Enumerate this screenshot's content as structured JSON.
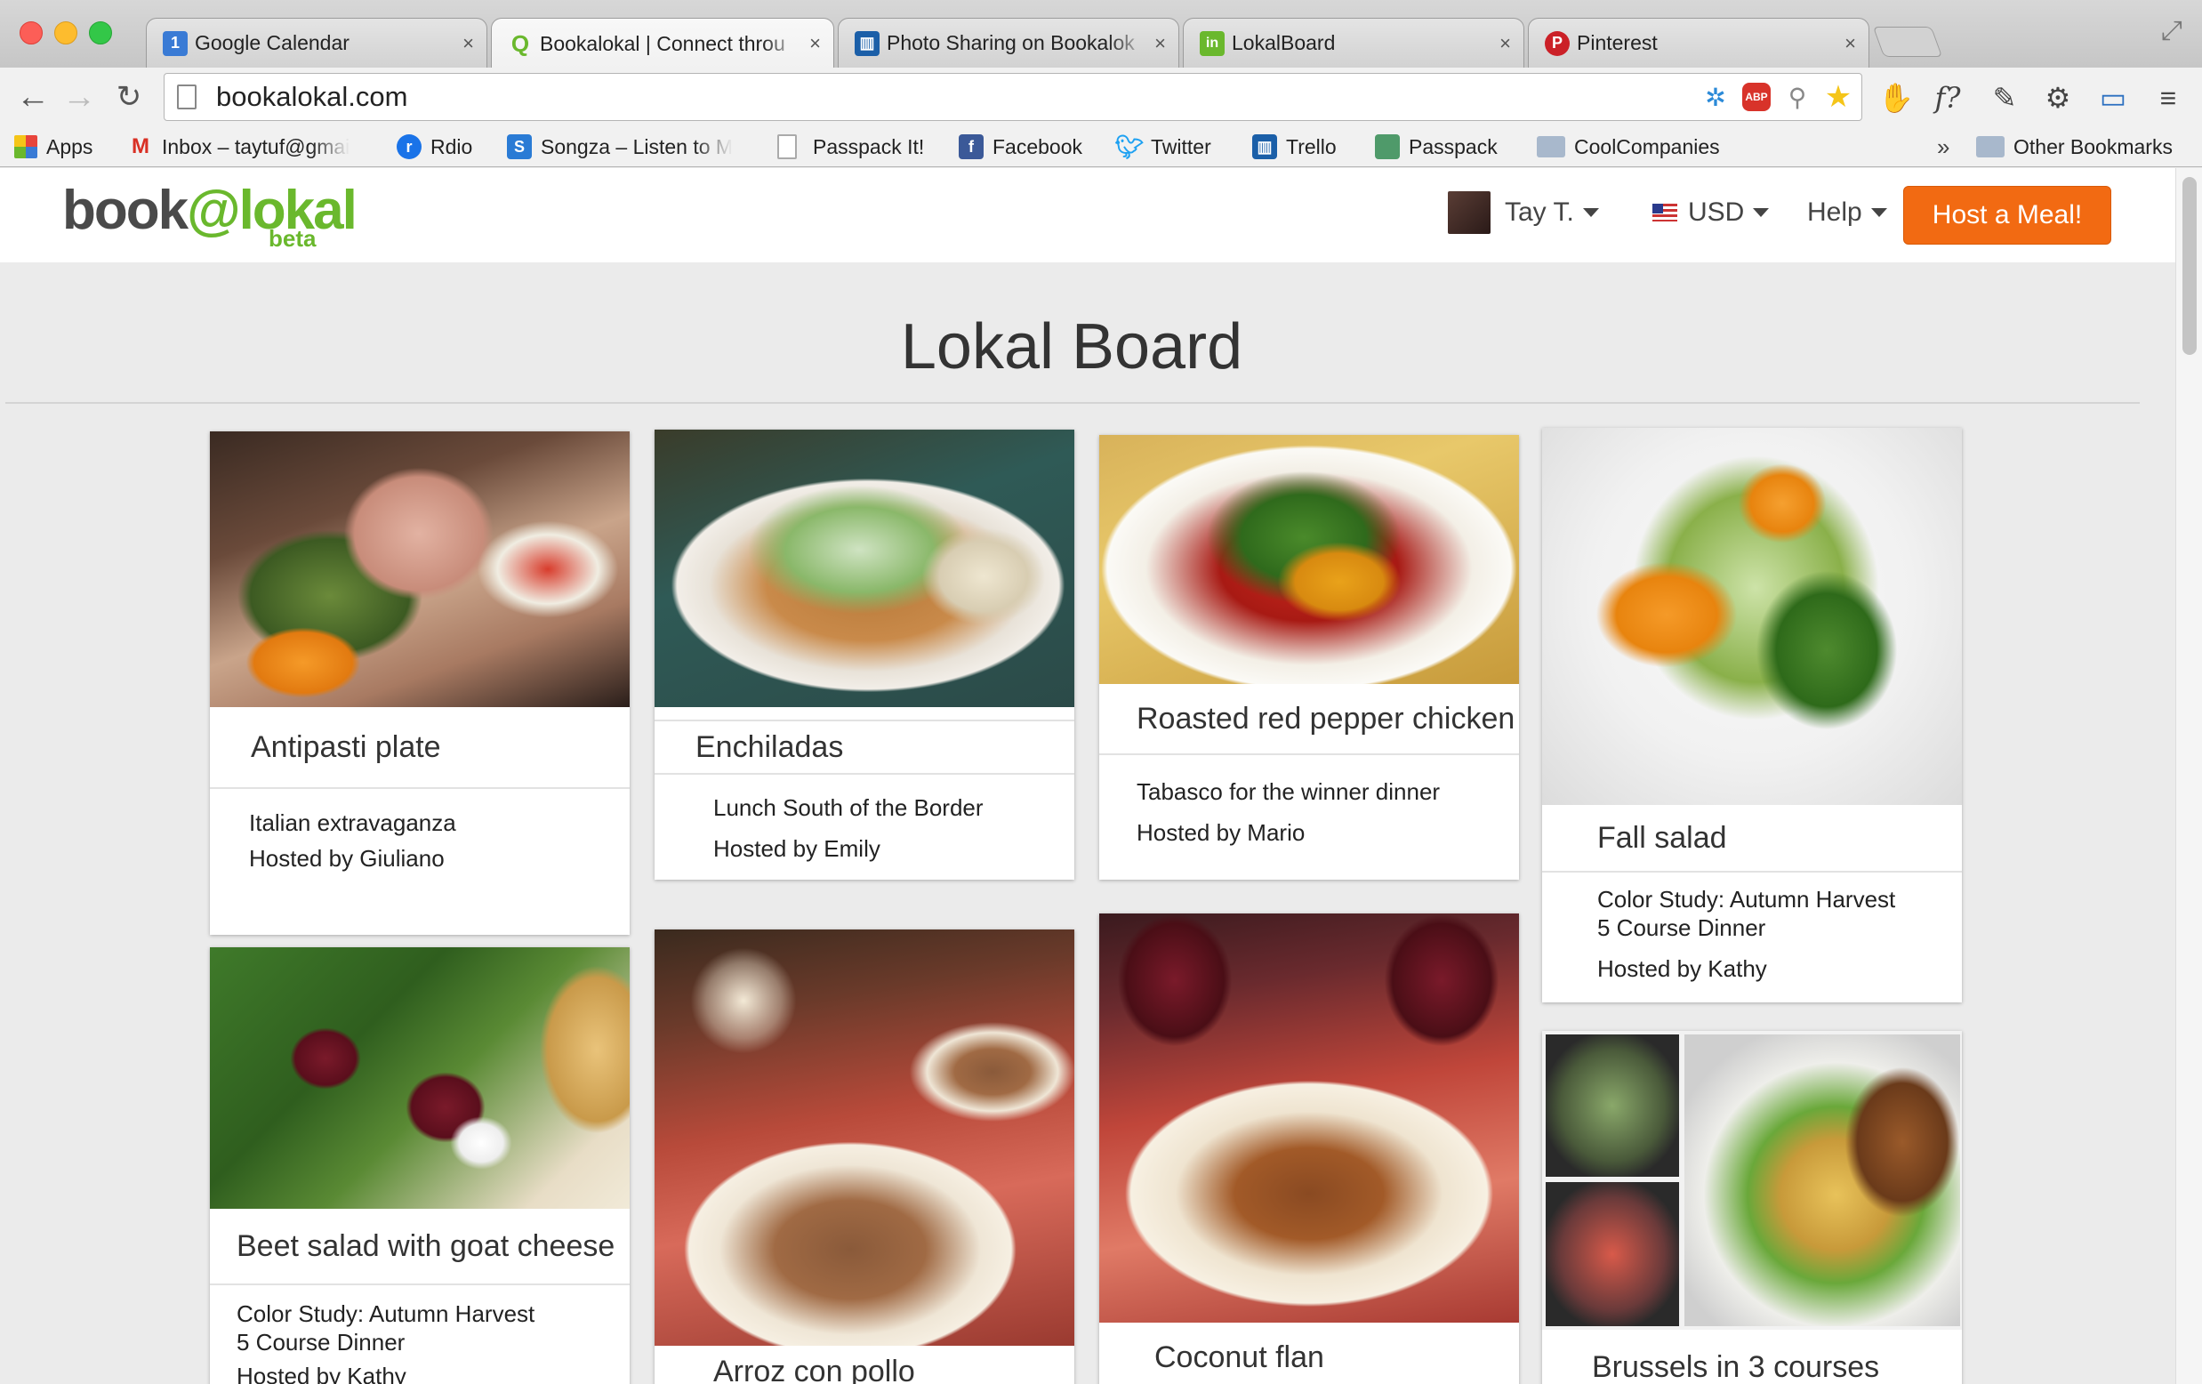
{
  "browser": {
    "tabs": [
      {
        "title": "Google Calendar",
        "favicon_color": "#3a7bd5",
        "favicon_text": "1"
      },
      {
        "title": "Bookalokal | Connect throu",
        "favicon_color": "#6ab82d",
        "favicon_text": "Q"
      },
      {
        "title": "Photo Sharing on Bookalok",
        "favicon_color": "#1b5fa8",
        "favicon_text": "▥"
      },
      {
        "title": "LokalBoard",
        "favicon_color": "#6ab82d",
        "favicon_text": "in"
      },
      {
        "title": "Pinterest",
        "favicon_color": "#cb2027",
        "favicon_text": "P"
      }
    ],
    "close_glyph": "×",
    "url": "bookalokal.com",
    "bookmarks": [
      {
        "label": "Apps",
        "icon": "apps-grid-icon",
        "color": "#e8453c"
      },
      {
        "label": "Inbox – taytuf@gmai",
        "icon": "gmail-icon",
        "color": "#d93025"
      },
      {
        "label": "Rdio",
        "icon": "rdio-icon",
        "color": "#1a73e8"
      },
      {
        "label": "Songza – Listen to M",
        "icon": "songza-icon",
        "color": "#2a7bd5"
      },
      {
        "label": "Passpack It!",
        "icon": "page-icon",
        "color": "#cfcfcf"
      },
      {
        "label": "Facebook",
        "icon": "facebook-icon",
        "color": "#3b5998"
      },
      {
        "label": "Twitter",
        "icon": "twitter-icon",
        "color": "#1da1f2"
      },
      {
        "label": "Trello",
        "icon": "trello-icon",
        "color": "#1b5fa8"
      },
      {
        "label": "Passpack",
        "icon": "passpack-icon",
        "color": "#4f9a6a"
      },
      {
        "label": "CoolCompanies",
        "icon": "folder-icon",
        "color": "#a8b8cc"
      }
    ],
    "overflow_chevron": "»",
    "other_bookmarks": "Other Bookmarks"
  },
  "site": {
    "logo_text": "bookalokal",
    "logo_badge": "beta",
    "user_name": "Tay T.",
    "currency": "USD",
    "help": "Help",
    "host_button": "Host a Meal!",
    "board_title": "Lokal Board"
  },
  "cards": [
    {
      "title": "Antipasti plate",
      "lines": [
        "Italian extravaganza",
        "Hosted by Giuliano"
      ]
    },
    {
      "title": "Enchiladas",
      "lines": [
        "Lunch South of the Border",
        "Hosted by Emily"
      ]
    },
    {
      "title": "Roasted red pepper chicken",
      "lines": [
        "Tabasco for the winner dinner",
        "Hosted by Mario"
      ]
    },
    {
      "title": "Fall salad",
      "lines": [
        "Color Study: Autumn Harvest",
        "5 Course Dinner",
        "Hosted by Kathy"
      ]
    },
    {
      "title": "Beet salad with goat cheese",
      "lines": [
        "Color Study: Autumn Harvest",
        "5 Course Dinner",
        "Hosted by Kathy"
      ]
    },
    {
      "title": "Arroz con pollo",
      "lines": []
    },
    {
      "title": "Coconut flan",
      "lines": []
    },
    {
      "title": "Brussels in 3 courses",
      "lines": []
    }
  ]
}
